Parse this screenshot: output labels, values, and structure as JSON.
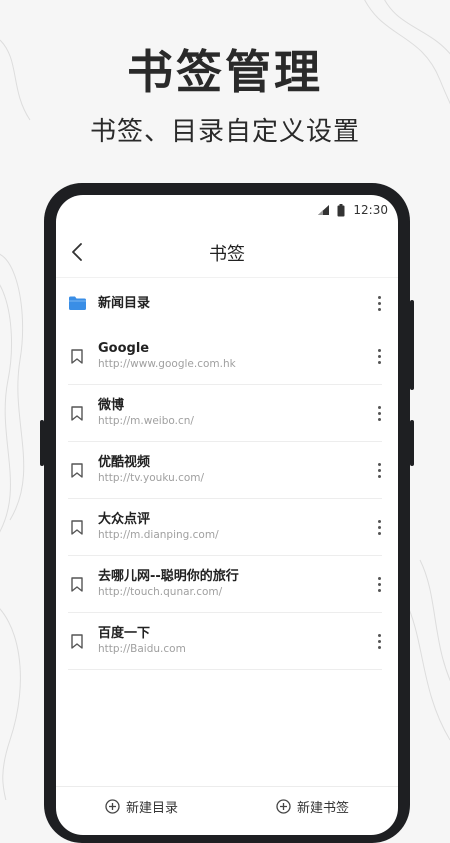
{
  "promo": {
    "headline": "书签管理",
    "subheadline": "书签、目录自定义设置"
  },
  "status_bar": {
    "time": "12:30"
  },
  "nav": {
    "title": "书签"
  },
  "folders": [
    {
      "title": "新闻目录"
    }
  ],
  "bookmarks": [
    {
      "title": "Google",
      "url": "http://www.google.com.hk"
    },
    {
      "title": "微博",
      "url": "http://m.weibo.cn/"
    },
    {
      "title": "优酷视频",
      "url": "http://tv.youku.com/"
    },
    {
      "title": "大众点评",
      "url": "http://m.dianping.com/"
    },
    {
      "title": "去哪儿网--聪明你的旅行",
      "url": "http://touch.qunar.com/"
    },
    {
      "title": "百度一下",
      "url": "http://Baidu.com"
    }
  ],
  "bottom_bar": {
    "new_folder_label": "新建目录",
    "new_bookmark_label": "新建书签"
  },
  "colors": {
    "folder_icon": "#3a8ee6",
    "phone_frame": "#1e1f22",
    "background": "#f6f6f6"
  }
}
